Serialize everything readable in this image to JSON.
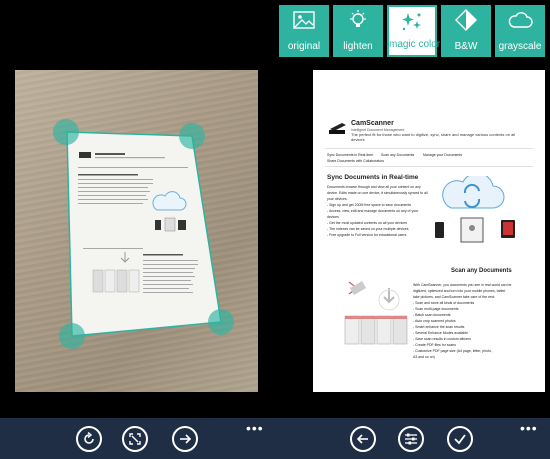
{
  "filters": [
    {
      "label": "original",
      "icon": "image-icon",
      "active": false
    },
    {
      "label": "lighten",
      "icon": "lightbulb-icon",
      "active": false
    },
    {
      "label": "magic color",
      "icon": "sparkle-icon",
      "active": true
    },
    {
      "label": "B&W",
      "icon": "contrast-icon",
      "active": false
    },
    {
      "label": "grayscale",
      "icon": "cloud-icon",
      "active": false
    }
  ],
  "document": {
    "app_name": "CamScanner",
    "tagline": "Intelligent Document Management",
    "intro": "The perfect fit for those who want to digitize, sync, share and manage various contents on all devices",
    "nav": [
      "Sync Documents in Real-time",
      "Scan any Documents",
      "Manage your Documents",
      "Share Documents with Collaborators"
    ],
    "section1_title": "Sync Documents in Real-time",
    "section1_body": [
      "Documents browse through and view all your content on any",
      "device. Edits made on one device, it simultaneously synced to all",
      "your devices.",
      "- Sign up and get 200M free space to save documents",
      "- Access, view, edit and manage documents on any of your",
      "  devices",
      "- Get the most updated contents on all your devices",
      "- The indexes can be saved on your multiple devices",
      "- Free upgrade to Full version for educational users"
    ],
    "section2_title": "Scan any Documents",
    "section2_body": [
      "With CamScanner, you documents you see in real world can be",
      "digitized, optimized and turn into your mobile phones, tablet",
      "take pictures, and CamScanner take care of the rest:",
      "- Scan and store all kinds of documents",
      "- Scan multi-page documents",
      "- Batch scan documents",
      "- Auto crop scanned photos",
      "- Smart enhance the scan results",
      "- Several Enhance Modes available",
      "- Save scan results in custom albums",
      "- Create PDF files for scans",
      "- Customize PDF page size (A4 page, letter, photo,",
      "  A3 and so on)"
    ]
  },
  "appbar": {
    "left": [
      {
        "icon": "rotate-icon",
        "name": "rotate-button"
      },
      {
        "icon": "crop-expand-icon",
        "name": "full-crop-button"
      },
      {
        "icon": "arrow-right-icon",
        "name": "next-button"
      }
    ],
    "right": [
      {
        "icon": "arrow-left-icon",
        "name": "back-button"
      },
      {
        "icon": "sliders-icon",
        "name": "adjust-button"
      },
      {
        "icon": "checkmark-icon",
        "name": "done-button"
      }
    ],
    "more_label": "•••"
  },
  "colors": {
    "accent": "#2fb3a1",
    "appbar": "#1f2e44"
  }
}
